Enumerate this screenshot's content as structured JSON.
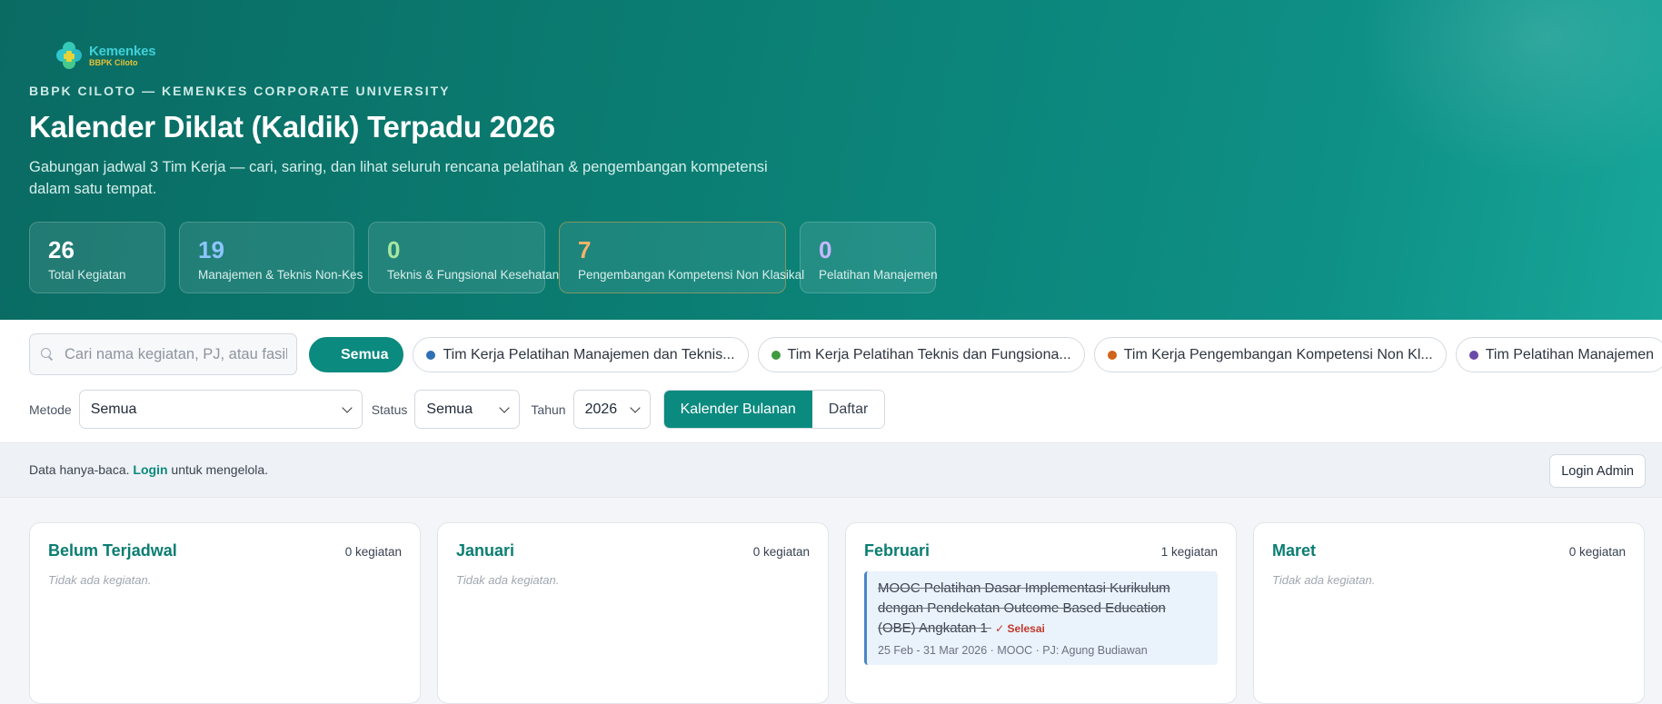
{
  "brand": {
    "name": "Kemenkes",
    "sub": "BBPK Ciloto"
  },
  "header": {
    "eyebrow": "BBPK CILOTO — KEMENKES CORPORATE UNIVERSITY",
    "title": "Kalender Diklat (Kaldik) Terpadu 2026",
    "subtitle": "Gabungan jadwal 3 Tim Kerja — cari, saring, dan lihat seluruh rencana pelatihan & pengembangan kompetensi dalam satu tempat."
  },
  "stats": [
    {
      "value": "26",
      "label": "Total Kegiatan",
      "color": "#ffffff"
    },
    {
      "value": "19",
      "label": "Manajemen & Teknis Non-Kes",
      "color": "#8ec5ff"
    },
    {
      "value": "0",
      "label": "Teknis & Fungsional Kesehatan",
      "color": "#a8e6a0"
    },
    {
      "value": "7",
      "label": "Pengembangan Kompetensi Non Klasikal",
      "color": "#f7b26a"
    },
    {
      "value": "0",
      "label": "Pelatihan Manajemen",
      "color": "#c7b8ff"
    }
  ],
  "search": {
    "placeholder": "Cari nama kegiatan, PJ, atau fasilitator"
  },
  "chips": [
    {
      "label": "Semua",
      "active": true
    },
    {
      "label": "Tim Kerja Pelatihan Manajemen dan Teknis...",
      "dot": "#2f6fb6"
    },
    {
      "label": "Tim Kerja Pelatihan Teknis dan Fungsiona...",
      "dot": "#3f9a3f"
    },
    {
      "label": "Tim Kerja Pengembangan Kompetensi Non Kl...",
      "dot": "#d0621a"
    },
    {
      "label": "Tim Pelatihan Manajemen",
      "dot": "#6a4aa8"
    }
  ],
  "filters": {
    "metode_label": "Metode",
    "metode_value": "Semua",
    "status_label": "Status",
    "status_value": "Semua",
    "tahun_label": "Tahun",
    "tahun_value": "2026"
  },
  "view": {
    "calendar": "Kalender Bulanan",
    "list": "Daftar"
  },
  "info": {
    "prefix": "Data hanya-baca.",
    "link": "Login",
    "suffix": "untuk mengelola.",
    "login_button": "Login Admin"
  },
  "months": [
    {
      "name": "Belum Terjadwal",
      "count": "0 kegiatan",
      "empty": "Tidak ada kegiatan."
    },
    {
      "name": "Januari",
      "count": "0 kegiatan",
      "empty": "Tidak ada kegiatan."
    },
    {
      "name": "Februari",
      "count": "1 kegiatan",
      "event": {
        "title": "MOOC Pelatihan Dasar Implementasi Kurikulum dengan Pendekatan Outcome Based Education (OBE) Angkatan 1",
        "status": "✓ Selesai",
        "meta": "25 Feb - 31 Mar 2026 · MOOC · PJ: Agung Budiawan"
      }
    },
    {
      "name": "Maret",
      "count": "0 kegiatan",
      "empty": "Tidak ada kegiatan."
    }
  ]
}
